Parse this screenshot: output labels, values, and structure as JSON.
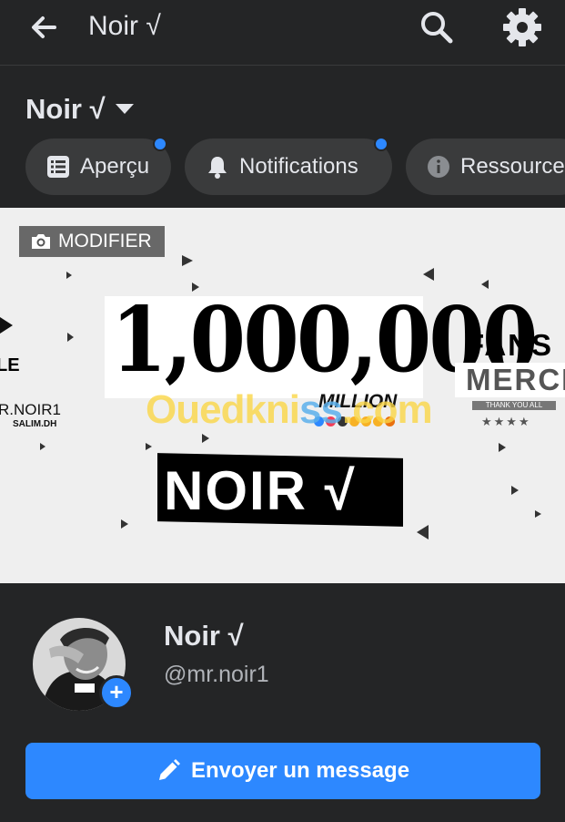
{
  "header": {
    "title": "Noir √",
    "back_icon": "arrow-left-icon",
    "search_icon": "search-icon",
    "settings_icon": "gear-icon"
  },
  "page_selector": {
    "name": "Noir √",
    "caret_icon": "caret-down-icon"
  },
  "tabs": [
    {
      "label": "Aperçu",
      "icon": "list-icon",
      "has_dot": true
    },
    {
      "label": "Notifications",
      "icon": "bell-icon",
      "has_dot": true
    },
    {
      "label": "Ressource",
      "icon": "info-icon",
      "has_dot": false
    }
  ],
  "cover": {
    "modifier_label": "MODIFIER",
    "camera_icon": "camera-icon",
    "big_count": "1,000,000",
    "million_label": "MILLION",
    "name_banner": "NOIR √",
    "left_text": "LE",
    "left_handle": "R.NOIR1",
    "left_sub": "SALIM.DH",
    "fans": "FANS",
    "merci": "MERCI",
    "thank_you": "THANK YOU ALL",
    "stars": "★★★★",
    "watermark_a": "Ouedkni",
    "watermark_b": "ss",
    "watermark_c": ".com"
  },
  "profile": {
    "name": "Noir √",
    "handle": "@mr.noir1",
    "add_icon": "plus-icon"
  },
  "actions": {
    "message_label": "Envoyer un message",
    "message_icon": "pencil-icon"
  },
  "colors": {
    "background": "#242526",
    "pill": "#3a3b3c",
    "accent": "#2d88ff",
    "text": "#e4e6eb",
    "secondary_text": "#b0b3b8"
  }
}
